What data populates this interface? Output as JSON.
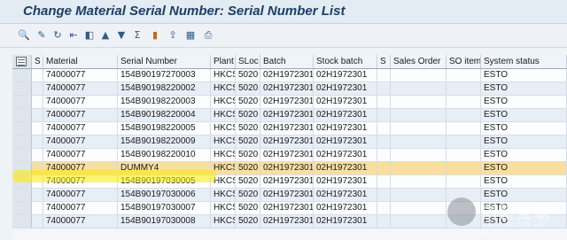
{
  "window": {
    "title": "Change Material Serial Number: Serial Number List"
  },
  "toolbar": {
    "icons": [
      "details-icon",
      "select-icon",
      "refresh-icon",
      "first-icon",
      "previous-icon",
      "sort-ascending-icon",
      "filter-icon",
      "sum-icon",
      "graphic-icon",
      "export-icon",
      "layout-icon",
      "print-icon"
    ]
  },
  "table": {
    "columns": [
      "S",
      "Material",
      "Serial Number",
      "Plant",
      "SLoc",
      "Batch",
      "Stock batch",
      "S",
      "Sales Order",
      "SO item",
      "System status"
    ],
    "rows": [
      [
        "",
        "74000077",
        "154B90197270003",
        "HKCS",
        "5020",
        "02H1972301",
        "02H1972301",
        "",
        "",
        "",
        "ESTO"
      ],
      [
        "",
        "74000077",
        "154B90198220002",
        "HKCS",
        "5020",
        "02H1972301",
        "02H1972301",
        "",
        "",
        "",
        "ESTO"
      ],
      [
        "",
        "74000077",
        "154B90198220003",
        "HKCS",
        "5020",
        "02H1972301",
        "02H1972301",
        "",
        "",
        "",
        "ESTO"
      ],
      [
        "",
        "74000077",
        "154B90198220004",
        "HKCS",
        "5020",
        "02H1972301",
        "02H1972301",
        "",
        "",
        "",
        "ESTO"
      ],
      [
        "",
        "74000077",
        "154B90198220005",
        "HKCS",
        "5020",
        "02H1972301",
        "02H1972301",
        "",
        "",
        "",
        "ESTO"
      ],
      [
        "",
        "74000077",
        "154B90198220009",
        "HKCS",
        "5020",
        "02H1972301",
        "02H1972301",
        "",
        "",
        "",
        "ESTO"
      ],
      [
        "",
        "74000077",
        "154B90198220010",
        "HKCS",
        "5020",
        "02H1972301",
        "02H1972301",
        "",
        "",
        "",
        "ESTO"
      ],
      [
        "",
        "74000077",
        "DUMMY4",
        "HKCS",
        "5020",
        "02H1972301",
        "02H1972301",
        "",
        "",
        "",
        "ESTO"
      ],
      [
        "",
        "74000077",
        "154B90197030005",
        "HKCS",
        "5020",
        "02H1972301",
        "02H1972301",
        "",
        "",
        "",
        "ESTO"
      ],
      [
        "",
        "74000077",
        "154B90197030006",
        "HKCS",
        "5020",
        "02H1972301",
        "02H1972301",
        "",
        "",
        "",
        "ESTO"
      ],
      [
        "",
        "74000077",
        "154B90197030007",
        "HKCS",
        "5020",
        "02H1972301",
        "02H1972301",
        "",
        "",
        "",
        "ESTO"
      ],
      [
        "",
        "74000077",
        "154B90197030008",
        "HKCS",
        "5020",
        "02H1972301",
        "02H1972301",
        "",
        "",
        "",
        "ESTO"
      ]
    ],
    "selected_row": 7
  },
  "watermark": {
    "cn": "创新互联",
    "en": "CHUANG XIN HU LIAN"
  },
  "colors": {
    "title": "#1d3f66",
    "selected_row": "#f9dea0",
    "highlight": "#ffeb00"
  }
}
